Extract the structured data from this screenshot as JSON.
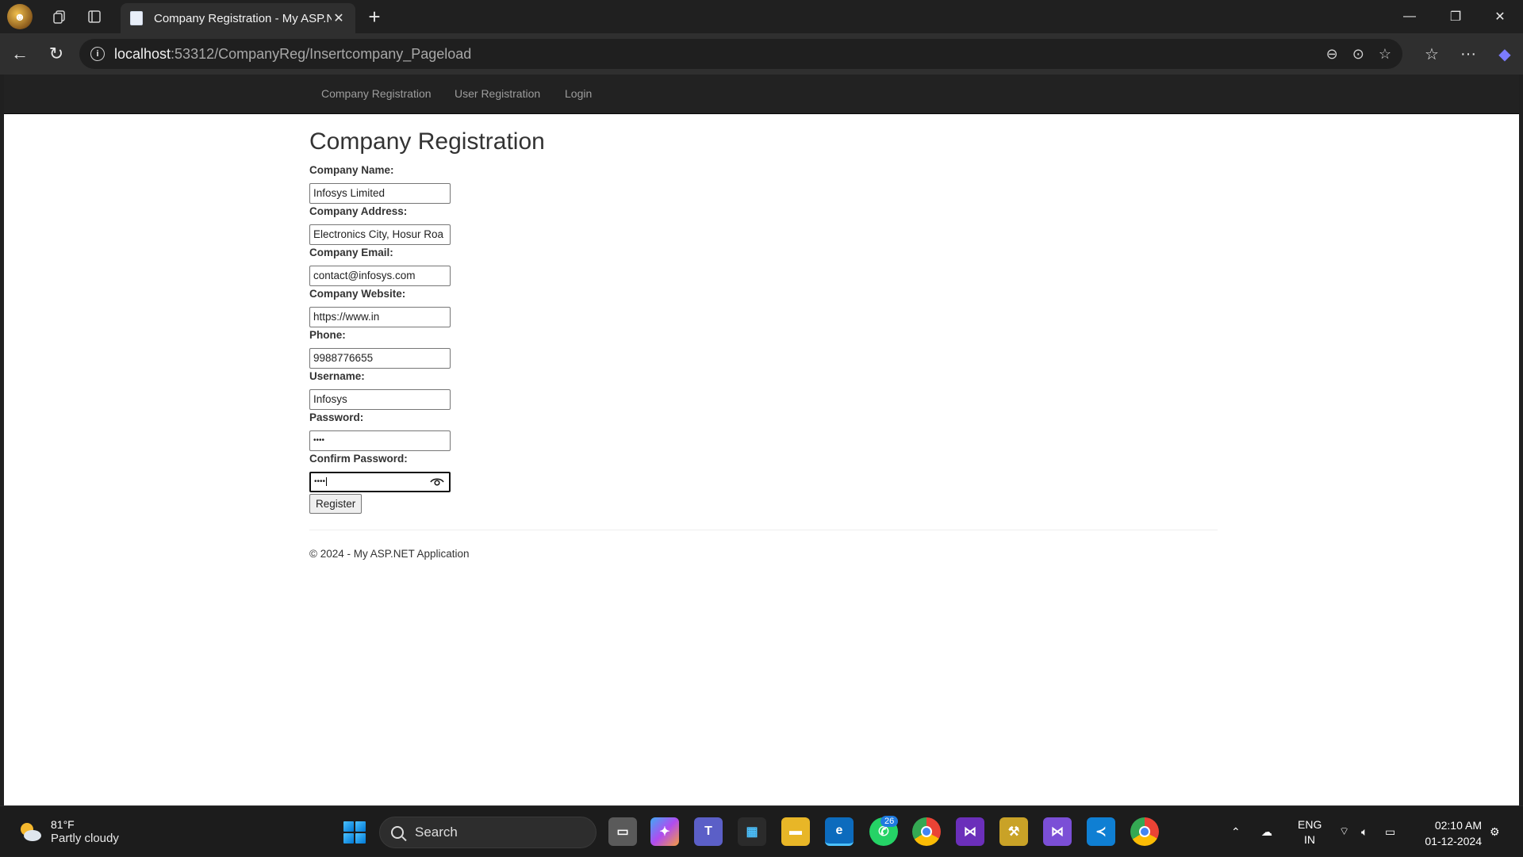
{
  "browser": {
    "tab_title": "Company Registration - My ASP.N",
    "url_host": "localhost",
    "url_rest": ":53312/CompanyReg/Insertcompany_Pageload"
  },
  "nav": {
    "links": [
      "Company Registration",
      "User Registration",
      "Login"
    ]
  },
  "page": {
    "title": "Company Registration",
    "fields": {
      "company_name": {
        "label": "Company Name:",
        "value": "Infosys Limited"
      },
      "company_address": {
        "label": "Company Address:",
        "value": "Electronics City, Hosur Roa"
      },
      "company_email": {
        "label": "Company Email:",
        "value": "contact@infosys.com"
      },
      "company_website": {
        "label": "Company Website:",
        "value": "https://www.in"
      },
      "phone": {
        "label": "Phone:",
        "value": "9988776655"
      },
      "username": {
        "label": "Username:",
        "value": "Infosys"
      },
      "password": {
        "label": "Password:",
        "value": "••••"
      },
      "confirm_password": {
        "label": "Confirm Password:",
        "value": "••••"
      }
    },
    "register_label": "Register",
    "footer": "© 2024 - My ASP.NET Application"
  },
  "taskbar": {
    "weather_temp": "81°F",
    "weather_desc": "Partly cloudy",
    "search_label": "Search",
    "whatsapp_badge": "26",
    "language_line1": "ENG",
    "language_line2": "IN",
    "time": "02:10 AM",
    "date": "01-12-2024"
  },
  "colors": {
    "navbar_bg": "#222222",
    "nav_link": "#9d9d9d",
    "browser_bg": "#202020"
  }
}
